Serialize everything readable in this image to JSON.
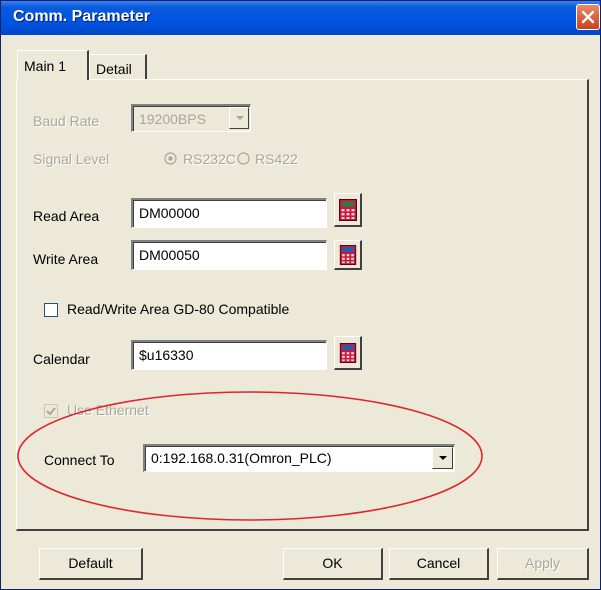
{
  "window": {
    "title": "Comm. Parameter"
  },
  "tabs": [
    {
      "label": "Main 1",
      "selected": true
    },
    {
      "label": "Detail",
      "selected": false
    }
  ],
  "main": {
    "baud_rate": {
      "label": "Baud Rate",
      "value": "19200BPS",
      "enabled": false
    },
    "signal_level": {
      "label": "Signal Level",
      "options": [
        {
          "label": "RS232C",
          "selected": true
        },
        {
          "label": "RS422",
          "selected": false
        }
      ],
      "enabled": false
    },
    "read_area": {
      "label": "Read Area",
      "value": "DM00000",
      "button_icon": "calculator-icon"
    },
    "write_area": {
      "label": "Write Area",
      "value": "DM00050",
      "button_icon": "calculator-icon"
    },
    "gd80_compatible": {
      "label": "Read/Write Area GD-80 Compatible",
      "checked": false
    },
    "calendar": {
      "label": "Calendar",
      "value": "$u16330",
      "button_icon": "calculator-icon"
    },
    "use_ethernet": {
      "label": "Use Ethernet",
      "checked": true,
      "enabled": false
    },
    "connect_to": {
      "label": "Connect To",
      "value": "0:192.168.0.31(Omron_PLC)"
    }
  },
  "buttons": {
    "default": "Default",
    "ok": "OK",
    "cancel": "Cancel",
    "apply": "Apply"
  },
  "annotation": {
    "shape": "ellipse",
    "color": "#e0242c"
  },
  "colors": {
    "titlebar": "#0054e3",
    "dialog_bg": "#ece9d8",
    "disabled_text": "#a9a79b",
    "close_button": "#c9411d"
  }
}
